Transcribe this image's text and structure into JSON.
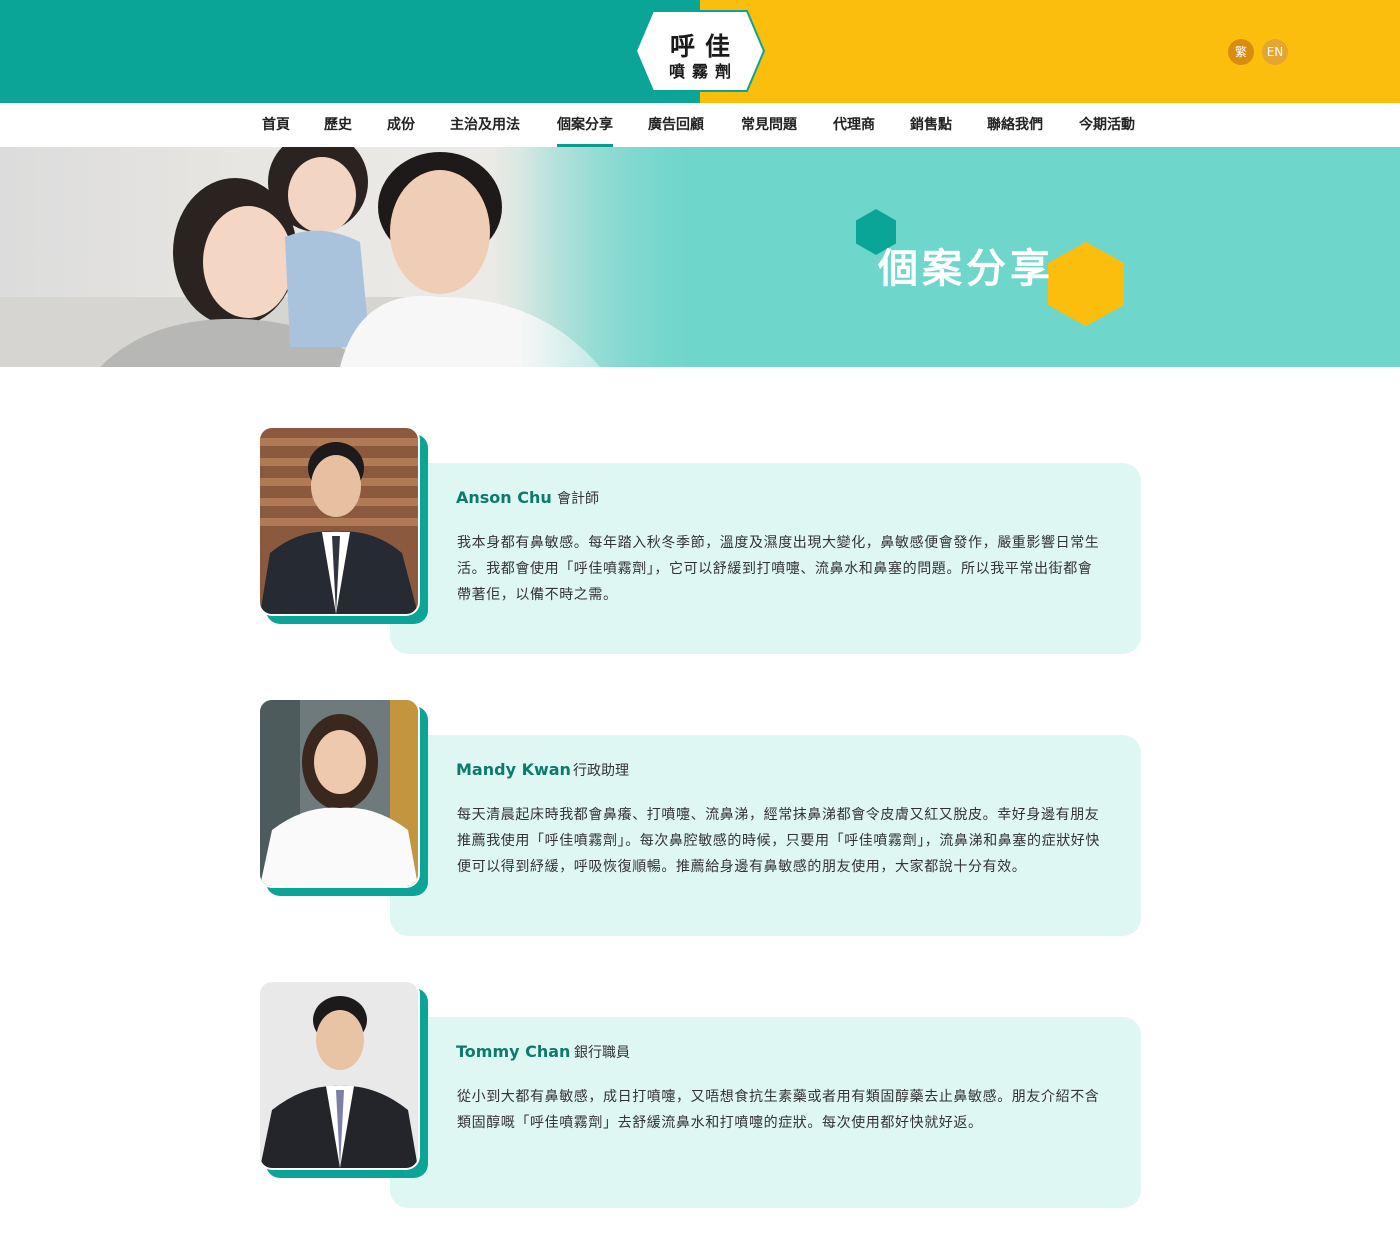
{
  "brand": {
    "logo_line1": "呼佳",
    "logo_line2": "噴霧劑"
  },
  "lang": {
    "zh": "繁",
    "en": "EN"
  },
  "nav": [
    {
      "label": "首頁"
    },
    {
      "label": "歷史"
    },
    {
      "label": "成份"
    },
    {
      "label": "主治及用法"
    },
    {
      "label": "個案分享"
    },
    {
      "label": "廣告回顧"
    },
    {
      "label": "常見問題"
    },
    {
      "label": "代理商"
    },
    {
      "label": "銷售點"
    },
    {
      "label": "聯絡我們"
    },
    {
      "label": "今期活動"
    }
  ],
  "nav_active_index": 4,
  "banner": {
    "title": "個案分享"
  },
  "colors": {
    "teal": "#0aa597",
    "yellow": "#fbbe0d",
    "card_bg": "#dff7f3",
    "name": "#0d7a6c"
  },
  "cases": [
    {
      "name": "Anson Chu",
      "role": "會計師",
      "text": "我本身都有鼻敏感。每年踏入秋冬季節，溫度及濕度出現大變化，鼻敏感便會發作，嚴重影響日常生活。我都會使用「呼佳噴霧劑」，它可以舒緩到打噴嚏、流鼻水和鼻塞的問題。所以我平常出街都會帶著佢，以備不時之需。"
    },
    {
      "name": "Mandy Kwan",
      "role": "行政助理",
      "text": "每天清晨起床時我都會鼻癢、打噴嚏、流鼻涕，經常抹鼻涕都會令皮膚又紅又脫皮。幸好身邊有朋友推薦我使用「呼佳噴霧劑」。每次鼻腔敏感的時候，只要用「呼佳噴霧劑」，流鼻涕和鼻塞的症狀好快便可以得到紓緩，呼吸恢復順暢。推薦給身邊有鼻敏感的朋友使用，大家都說十分有效。"
    },
    {
      "name": "Tommy Chan",
      "role": "銀行職員",
      "text": "從小到大都有鼻敏感，成日打噴嚏，又唔想食抗生素藥或者用有類固醇藥去止鼻敏感。朋友介紹不含類固醇嘅「呼佳噴霧劑」去舒緩流鼻水和打噴嚏的症狀。每次使用都好快就好返。"
    }
  ]
}
